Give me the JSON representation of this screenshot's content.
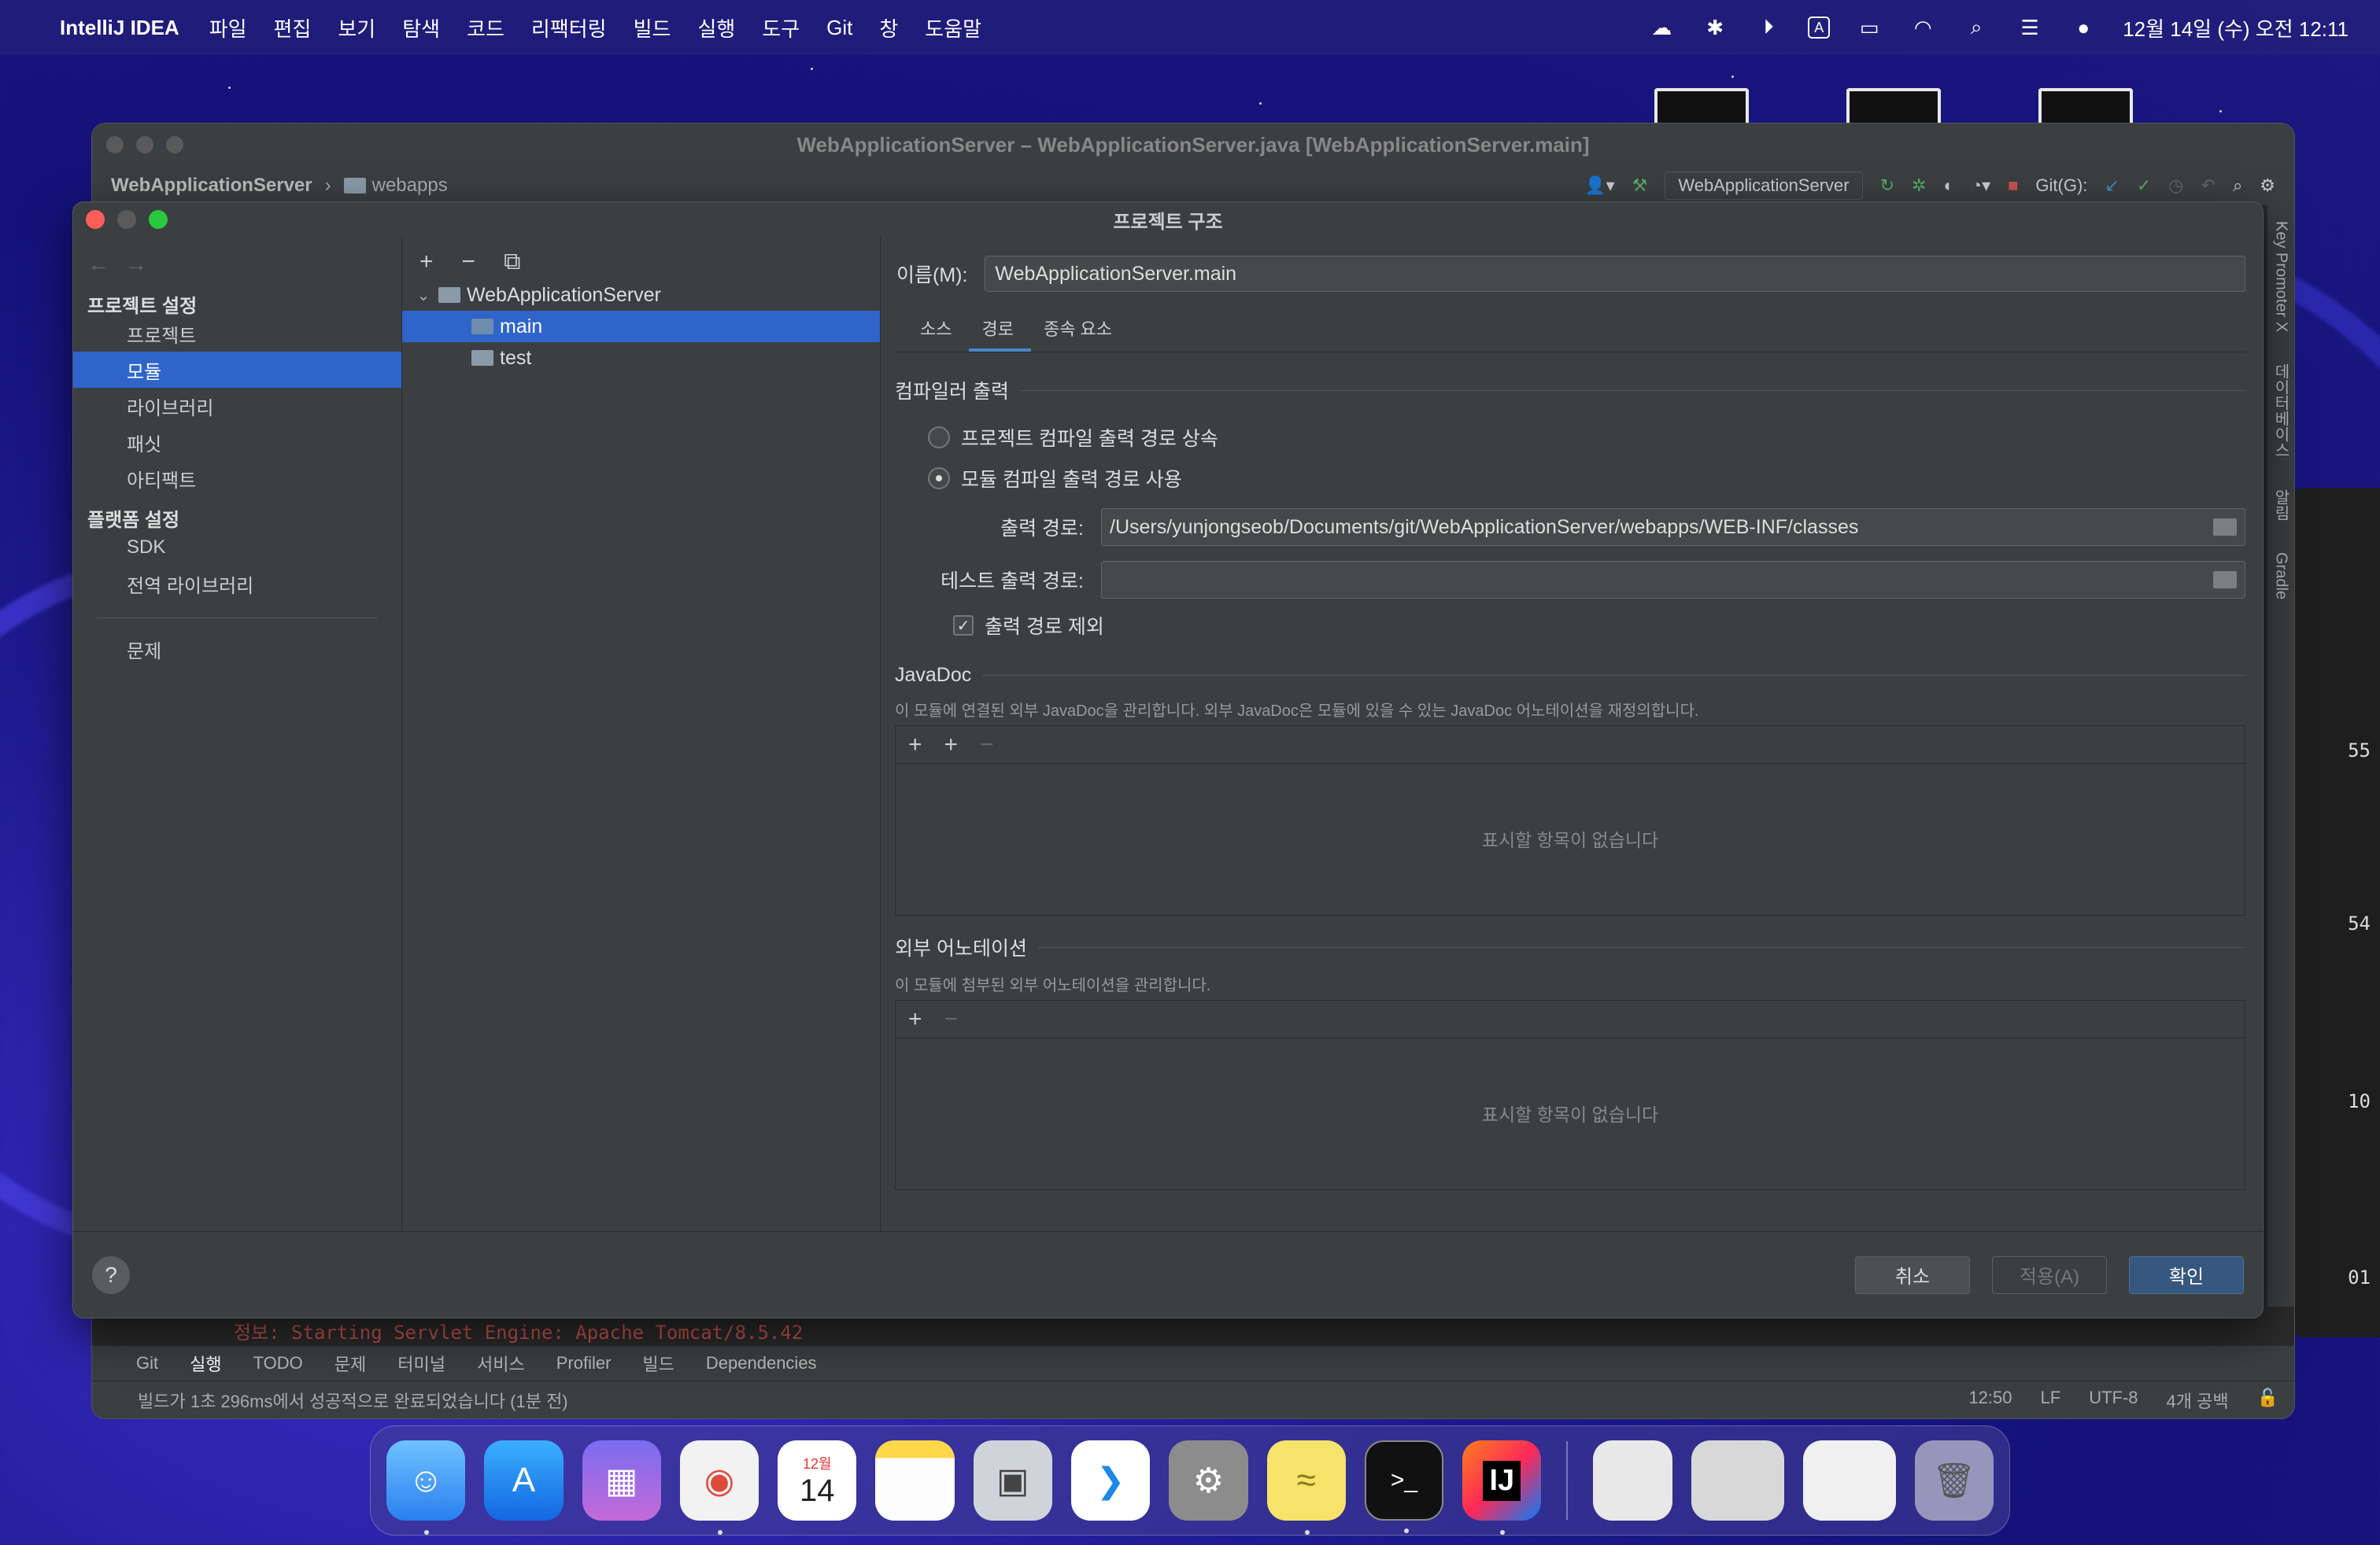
{
  "menubar": {
    "app_name": "IntelliJ IDEA",
    "menus": [
      "파일",
      "편집",
      "보기",
      "탐색",
      "코드",
      "리팩터링",
      "빌드",
      "실행",
      "도구",
      "Git",
      "창",
      "도움말"
    ],
    "input_indicator": "A",
    "clock": "12월 14일 (수) 오전 12:11"
  },
  "ide": {
    "title": "WebApplicationServer – WebApplicationServer.java [WebApplicationServer.main]",
    "breadcrumb": [
      "WebApplicationServer",
      "webapps"
    ],
    "run_config": "WebApplicationServer",
    "git_label": "Git(G):",
    "console_line": "정보: Starting Servlet Engine: Apache Tomcat/8.5.42",
    "bottom_tabs": [
      "Git",
      "실행",
      "TODO",
      "문제",
      "터미널",
      "서비스",
      "Profiler",
      "빌드",
      "Dependencies"
    ],
    "status_message": "빌드가 1초 296ms에서 성공적으로 완료되었습니다 (1분 전)",
    "status_right": [
      "12:50",
      "LF",
      "UTF-8",
      "4개 공백"
    ],
    "side_tools": [
      "Key Promoter X",
      "데이터베이스",
      "알림",
      "Gradle"
    ]
  },
  "dialog": {
    "title": "프로젝트 구조",
    "sidebar": {
      "project_settings_header": "프로젝트 설정",
      "project_items": [
        "프로젝트",
        "모듈",
        "라이브러리",
        "패싯",
        "아티팩트"
      ],
      "platform_settings_header": "플랫폼 설정",
      "platform_items": [
        "SDK",
        "전역 라이브러리"
      ],
      "problems": "문제"
    },
    "tree": {
      "root": "WebApplicationServer",
      "children": [
        "main",
        "test"
      ]
    },
    "content": {
      "name_label": "이름(M):",
      "name_value": "WebApplicationServer.main",
      "tabs": [
        "소스",
        "경로",
        "종속 요소"
      ],
      "compiler_output_title": "컴파일러 출력",
      "radio_inherit": "프로젝트 컴파일 출력 경로 상속",
      "radio_module": "모듈 컴파일 출력 경로 사용",
      "output_path_label": "출력 경로:",
      "output_path_value": "/Users/yunjongseob/Documents/git/WebApplicationServer/webapps/WEB-INF/classes",
      "test_output_label": "테스트 출력 경로:",
      "test_output_value": "",
      "exclude_output_label": "출력 경로 제외",
      "javadoc_title": "JavaDoc",
      "javadoc_desc": "이 모듈에 연결된 외부 JavaDoc을 관리합니다. 외부 JavaDoc은 모듈에 있을 수 있는 JavaDoc 어노테이션을 재정의합니다.",
      "empty_list": "표시할 항목이 없습니다",
      "annotations_title": "외부 어노테이션",
      "annotations_desc": "이 모듈에 첨부된 외부 어노테이션을 관리합니다."
    },
    "footer": {
      "help": "?",
      "cancel": "취소",
      "apply": "적용(A)",
      "ok": "확인"
    }
  },
  "dock": {
    "calendar_month": "12월",
    "calendar_day": "14",
    "intellij_label": "IJ"
  },
  "terminal_partial": [
    "55",
    "54",
    "10",
    "01"
  ],
  "colors": {
    "selection": "#2f65ca",
    "primary_button": "#365880",
    "dialog_bg": "#3c3f41",
    "console_error": "#c75450"
  }
}
